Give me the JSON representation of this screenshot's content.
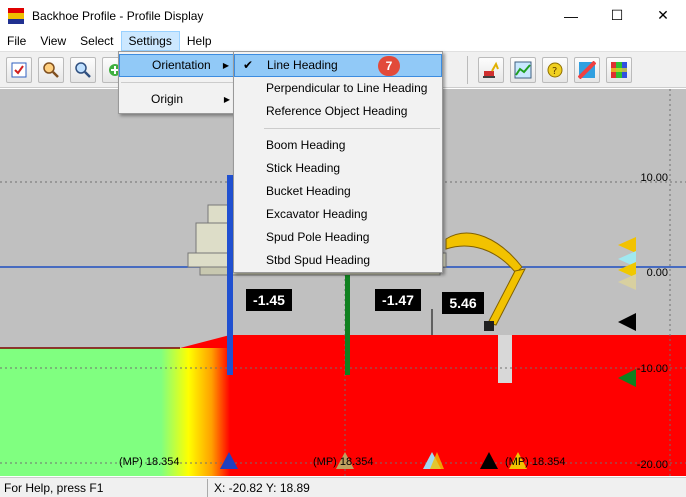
{
  "window": {
    "title": "Backhoe Profile - Profile Display",
    "minimize": "—",
    "maximize": "☐",
    "close": "✕"
  },
  "menubar": {
    "file": "File",
    "view": "View",
    "select": "Select",
    "settings": "Settings",
    "help": "Help"
  },
  "settings_menu": {
    "orientation": "Orientation",
    "origin": "Origin"
  },
  "orientation_menu": {
    "items": [
      "Line Heading",
      "Perpendicular to Line Heading",
      "Reference Object Heading",
      "Boom Heading",
      "Stick Heading",
      "Bucket Heading",
      "Excavator Heading",
      "Spud Pole Heading",
      "Stbd Spud Heading"
    ],
    "checked": "Line Heading",
    "badge": "7"
  },
  "profile": {
    "depth_labels": [
      "10.00",
      "0.00",
      "-10.00",
      "-20.00"
    ],
    "value_labels": [
      "-1.45",
      "-1.47",
      "5.46"
    ],
    "mp_labels": [
      "(MP) 18.354",
      "(MP) 18.354",
      "(MP) 18.354"
    ],
    "colors": {
      "canvas_bg": "#c0c0c0",
      "seabed_red": "#ff0000",
      "shallow_green": "#80ff80",
      "waterline_blue": "#1f4fc0",
      "boom_yellow": "#f2c200"
    }
  },
  "status": {
    "help": "For Help, press F1",
    "coords": "X: -20.82  Y: 18.89"
  }
}
